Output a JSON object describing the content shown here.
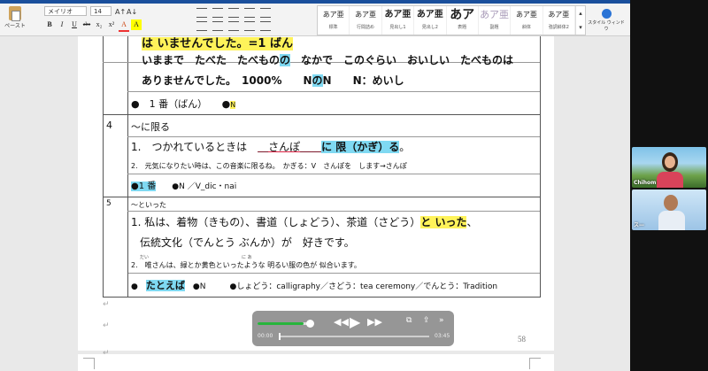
{
  "ribbon": {
    "paste_label": "ペースト",
    "font_name": "メイリオ",
    "font_size": "14",
    "font_grow": "A↑",
    "font_shrink": "A↓",
    "format_buttons": [
      "B",
      "I",
      "U",
      "abc",
      "x₂",
      "x²",
      "A",
      "A"
    ],
    "styles": [
      {
        "sample": "あア亜",
        "name": "標準"
      },
      {
        "sample": "あア亜",
        "name": "行間詰め"
      },
      {
        "sample": "あア亜",
        "name": "見出し1"
      },
      {
        "sample": "あア亜",
        "name": "見出し2"
      },
      {
        "sample": "あア",
        "name": "表題"
      },
      {
        "sample": "あア亜",
        "name": "副題"
      },
      {
        "sample": "あア亜",
        "name": "斜体"
      },
      {
        "sample": "あア亜",
        "name": "強調斜体2"
      }
    ],
    "style_window_label": "スタイル ウィンドウ"
  },
  "doc": {
    "row_top": {
      "line1": "は いませんでした。=1 ばん",
      "line2_parts": [
        "いままで　たべた　たべもの",
        "の",
        "　なかで　このぐらい　おいしい　たべものは"
      ],
      "line3_parts": [
        "ありませんでした。　1000%　　N",
        "の",
        "N　　N：めいし"
      ],
      "bullet_text": "●　1 番（ばん）　　●",
      "bullet_n": "N"
    },
    "row4": {
      "number": "4",
      "title": "～に限る",
      "ex1_prefix": "1.　つかれているときは　",
      "ex1_mid": "＿さんぽ＿＿",
      "ex1_hl": "に 限（かぎ）る",
      "ex1_end": "。",
      "ex2": "2.　元気になりたい時は、この音楽に限るね。　かぎる：V　さんぽを　します→さんぽ",
      "bullet_hl": "●1 番",
      "bullet_rest": "●N ／V_dic・nai"
    },
    "row5": {
      "number": "5",
      "title": "～といった",
      "ex1_pre": "1. 私は、着物（きもの）、書道（しょどう）、茶道（さどう）",
      "ex1_hl": "と いった",
      "ex1_end": "、",
      "ex1_line2": "伝統文化（でんとう ぶんか）が　好きです。",
      "ruby_note": "だい　　　　　　　　　　　　　　　　　　　　　に あ",
      "ex2": "2.　唯さんは、緑とか黄色といったような 明るい服の色が 似合います。",
      "bullet": "●",
      "bullet_hl": "たとえば",
      "bullet_n": "●N",
      "bullet_terms": "●しょどう：calligraphy／さどう：tea ceremony／でんとう：Tradition"
    },
    "page_number": "58"
  },
  "player": {
    "elapsed": "00:00",
    "total": "03:45",
    "volume_fraction": 0.9
  },
  "participants": [
    {
      "name": "Chihom"
    },
    {
      "name": "ス—"
    }
  ],
  "colors": {
    "highlight_yellow": "#fff35a",
    "highlight_blue": "#7fd9f2",
    "title_bar": "#1a4f9c"
  }
}
